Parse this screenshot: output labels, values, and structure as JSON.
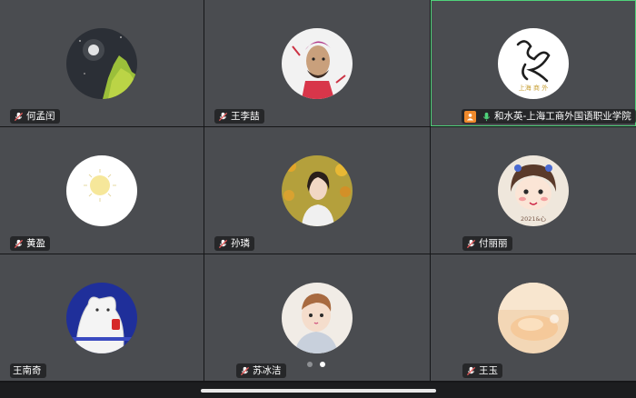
{
  "participants": [
    {
      "name": "何孟闰",
      "mic": "muted",
      "avatar": "night-sky-tree"
    },
    {
      "name": "王李喆",
      "mic": "muted",
      "avatar": "footballer-portrait"
    },
    {
      "name": "和水英-上海工商外国语职业学院",
      "mic": "active",
      "avatar": "calligraphy-logo",
      "host": true,
      "logo_text": "上海 商 外"
    },
    {
      "name": "黄盈",
      "mic": "muted",
      "avatar": "white-sun"
    },
    {
      "name": "孙璘",
      "mic": "muted",
      "avatar": "woman-in-flowers"
    },
    {
      "name": "付丽丽",
      "mic": "muted",
      "avatar": "cartoon-girl",
      "sticker_text": "2021&心"
    },
    {
      "name": "王南奇",
      "mic": "none",
      "avatar": "cartoon-cat"
    },
    {
      "name": "苏冰洁",
      "mic": "muted",
      "avatar": "baby-photo"
    },
    {
      "name": "王玉",
      "mic": "muted",
      "avatar": "warm-light-photo"
    }
  ],
  "pager": {
    "pages": 2,
    "current": 2
  },
  "colors": {
    "tile_bg": "#4a4c50",
    "active_border": "#4fd27a",
    "host_badge": "#f08a2c",
    "mic_active": "#4fd27a",
    "mic_muted": "#e05a5a"
  }
}
